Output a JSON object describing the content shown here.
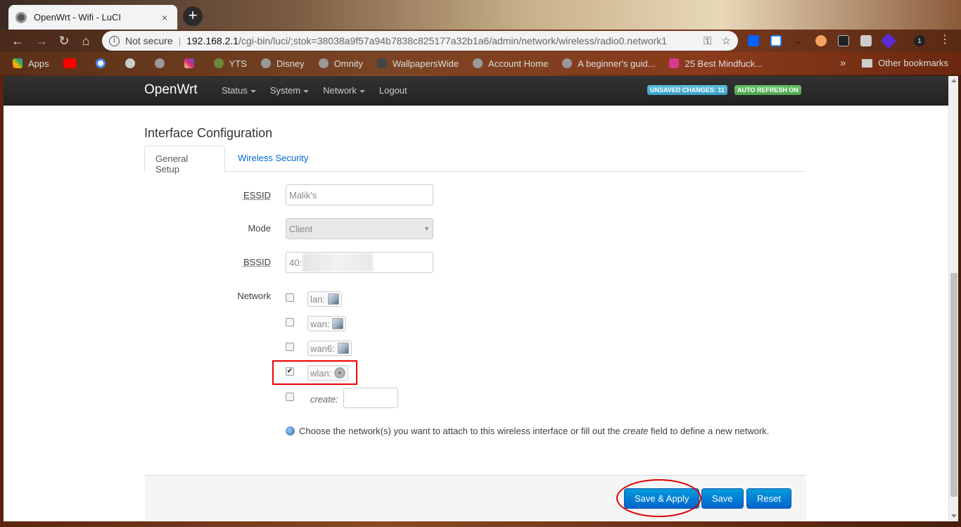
{
  "browser": {
    "tab_title": "OpenWrt - Wifi - LuCI",
    "tab_close": "×",
    "new_tab": "+",
    "security_label": "Not secure",
    "url_host": "192.168.2.1",
    "url_path": "/cgi-bin/luci/;stok=38038a9f57a94b7838c825177a32b1a6/admin/network/wireless/radio0.network1",
    "bookmarks": [
      "Apps",
      "",
      "",
      "",
      "",
      "YTS",
      "Disney",
      "Omnity",
      "WallpapersWide",
      "Account Home",
      "A beginner's guid...",
      "25 Best Mindfuck..."
    ],
    "bookmarks_more": "»",
    "other_bookmarks": "Other bookmarks"
  },
  "navbar": {
    "brand": "OpenWrt",
    "menu": [
      "Status",
      "System",
      "Network",
      "Logout"
    ],
    "unsaved_badge": "UNSAVED CHANGES: 11",
    "refresh_badge": "AUTO REFRESH ON"
  },
  "main": {
    "heading": "Interface Configuration",
    "tabs": [
      "General Setup",
      "Wireless Security"
    ],
    "fields": {
      "essid_label": "ESSID",
      "essid_value": "Malik's",
      "mode_label": "Mode",
      "mode_value": "Client",
      "bssid_label": "BSSID",
      "bssid_value": "40:",
      "network_label": "Network"
    },
    "networks": [
      {
        "name": "lan:",
        "checked": false
      },
      {
        "name": "wan:",
        "checked": false
      },
      {
        "name": "wan6:",
        "checked": false
      },
      {
        "name": "wlan:",
        "checked": true
      }
    ],
    "create_label": "create:",
    "help_before": "Choose the network(s) you want to attach to this wireless interface or fill out the ",
    "help_em": "create",
    "help_after": " field to define a new network."
  },
  "actions": {
    "save_apply": "Save & Apply",
    "save": "Save",
    "reset": "Reset"
  },
  "colors": {
    "button_blue": "#0069d6",
    "badge_unsaved": "#5bc0de",
    "badge_refresh": "#62c462",
    "annotation_red": "#e00000"
  }
}
